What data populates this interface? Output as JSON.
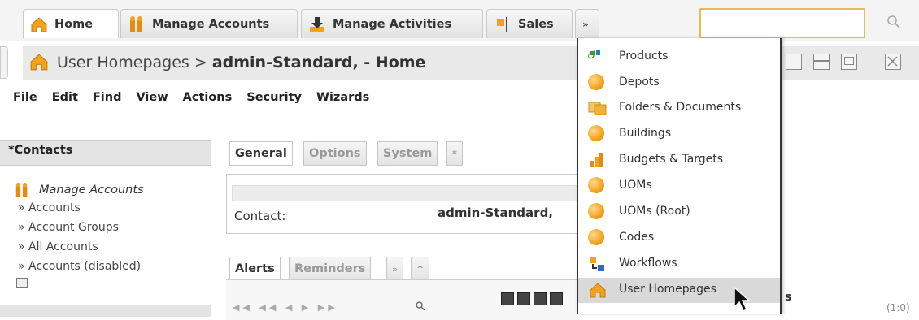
{
  "tabs": [
    {
      "label": "Home",
      "icon": "home-icon"
    },
    {
      "label": "Manage Accounts",
      "icon": "people-icon"
    },
    {
      "label": "Manage Activities",
      "icon": "download-icon"
    },
    {
      "label": "Sales",
      "icon": "flag-icon"
    }
  ],
  "more_tabs_label": "»",
  "search": {
    "value": ""
  },
  "breadcrumb": {
    "prefix": "User Homepages > ",
    "current": "admin-Standard, - Home"
  },
  "menubar": [
    "File",
    "Edit",
    "Find",
    "View",
    "Actions",
    "Security",
    "Wizards"
  ],
  "sidebar": {
    "section_title": "*Contacts",
    "manage_accounts": "Manage Accounts",
    "links": [
      "» Accounts",
      "» Account Groups",
      "» All Accounts",
      "» Accounts (disabled)"
    ]
  },
  "content_tabs": [
    "General",
    "Options",
    "System",
    "*"
  ],
  "form": {
    "contact_label": "Contact:",
    "contact_value": "admin-Standard,"
  },
  "bottom_tabs": [
    "Alerts",
    "Reminders",
    "»",
    "^"
  ],
  "right_fragment": "s",
  "right_count": "(1:0)",
  "dropdown_items": [
    {
      "label": "Products",
      "icon": "products-icon"
    },
    {
      "label": "Depots",
      "icon": "ball-icon"
    },
    {
      "label": "Folders & Documents",
      "icon": "folders-icon"
    },
    {
      "label": "Buildings",
      "icon": "ball-icon"
    },
    {
      "label": "Budgets & Targets",
      "icon": "bar-chart-icon"
    },
    {
      "label": "UOMs",
      "icon": "ball-icon"
    },
    {
      "label": "UOMs (Root)",
      "icon": "ball-icon"
    },
    {
      "label": "Codes",
      "icon": "ball-icon"
    },
    {
      "label": "Workflows",
      "icon": "workflow-icon"
    },
    {
      "label": "User Homepages",
      "icon": "home-icon"
    }
  ],
  "colors": {
    "accent": "#f3a21d",
    "search_border": "#e3bb57"
  }
}
